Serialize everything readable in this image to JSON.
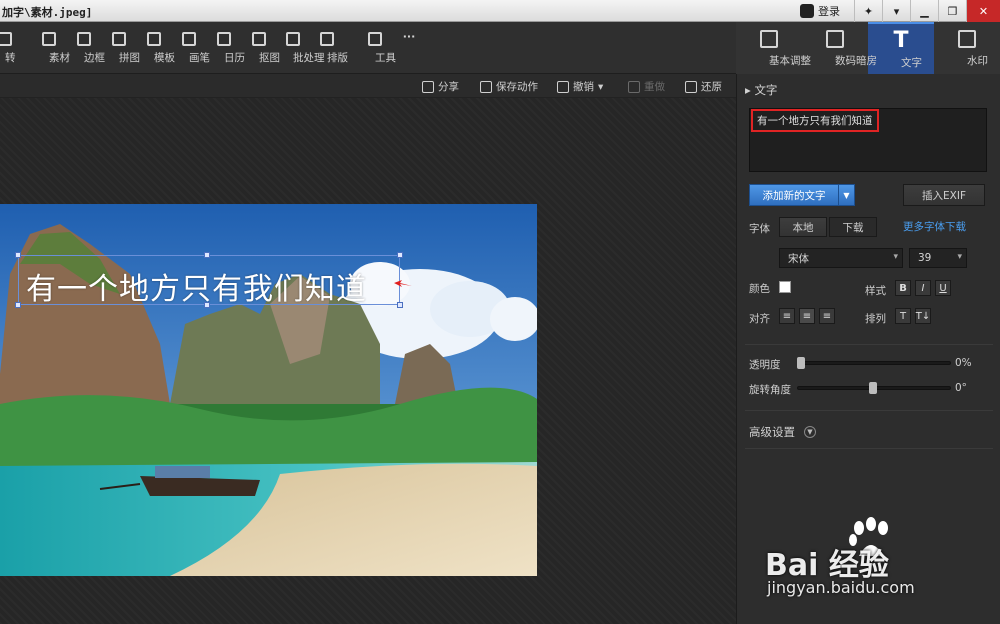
{
  "titlebar": {
    "title": "加字\\素材.jpeg]",
    "login": "登录"
  },
  "toolbar": {
    "items": [
      {
        "label": "转",
        "icon": "rotate-icon"
      },
      {
        "label": "素材",
        "icon": "star-icon"
      },
      {
        "label": "边框",
        "icon": "frame-icon"
      },
      {
        "label": "拼图",
        "icon": "grid-icon"
      },
      {
        "label": "模板",
        "icon": "template-icon"
      },
      {
        "label": "画笔",
        "icon": "brush-icon"
      },
      {
        "label": "日历",
        "icon": "calendar-icon"
      },
      {
        "label": "抠图",
        "icon": "pin-icon"
      },
      {
        "label": "批处理",
        "icon": "batch-icon"
      },
      {
        "label": "排版",
        "icon": "layout-icon"
      },
      {
        "label": "工具",
        "icon": "wrench-icon"
      }
    ],
    "more": "···"
  },
  "right_tabs": [
    {
      "label": "基本调整",
      "icon": "adjust-icon"
    },
    {
      "label": "数码暗房",
      "icon": "camera-icon"
    },
    {
      "label": "文字",
      "icon": "text-icon",
      "glyph": "T"
    },
    {
      "label": "水印",
      "icon": "watermark-icon"
    }
  ],
  "actionbar": {
    "share": "分享",
    "save_action": "保存动作",
    "undo": "撤销",
    "redo": "重做",
    "restore": "还原"
  },
  "canvas": {
    "overlay_text": "有一个地方只有我们知道"
  },
  "panel": {
    "section_title": "文字",
    "text_value": "有一个地方只有我们知道",
    "add_text_button": "添加新的文字",
    "insert_exif_button": "插入EXIF",
    "font_label": "字体",
    "font_local": "本地",
    "font_download": "下载",
    "more_fonts_link": "更多字体下载",
    "font_family": "宋体",
    "font_size": "39",
    "color_label": "颜色",
    "text_color": "#ffffff",
    "style_label": "样式",
    "style_bold": "B",
    "style_italic": "I",
    "style_underline": "U",
    "align_label": "对齐",
    "arrange_label": "排列",
    "opacity_label": "透明度",
    "opacity_value": "0%",
    "opacity_fraction": 0,
    "rotation_label": "旋转角度",
    "rotation_value": "0°",
    "advanced_label": "高级设置"
  },
  "watermark": {
    "brand": "Bai  经验",
    "url": "jingyan.baidu.com"
  }
}
